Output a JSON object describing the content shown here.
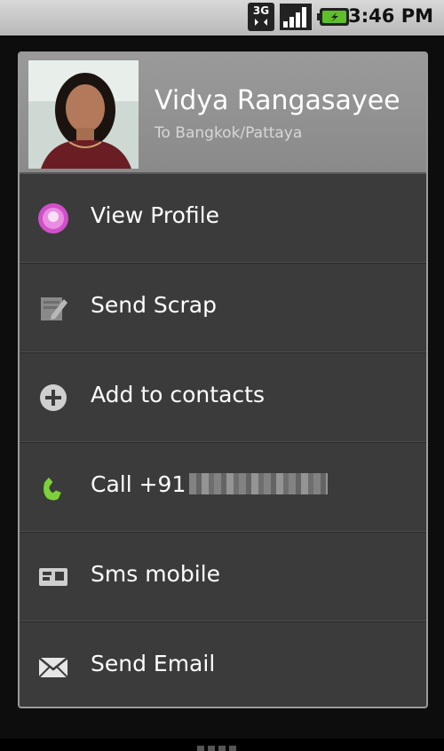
{
  "status_bar": {
    "network": "3G",
    "time": "3:46 PM",
    "icons": [
      "3g-icon",
      "signal-icon",
      "battery-icon"
    ]
  },
  "contact": {
    "name": "Vidya Rangasayee",
    "subtitle": "To Bangkok/Pattaya"
  },
  "menu": [
    {
      "label": "View Profile",
      "icon": "profile-icon"
    },
    {
      "label": "Send Scrap",
      "icon": "edit-icon"
    },
    {
      "label": "Add to contacts",
      "icon": "add-contact-icon"
    },
    {
      "label": "Call +91",
      "icon": "phone-icon"
    },
    {
      "label": "Sms mobile",
      "icon": "sms-icon"
    },
    {
      "label": "Send Email",
      "icon": "email-icon"
    }
  ],
  "colors": {
    "dialog_bg": "#3b3b3b",
    "header_bg": "#8f8f8f",
    "accent_profile": "#d24fc9",
    "accent_phone": "#7bd13a"
  }
}
